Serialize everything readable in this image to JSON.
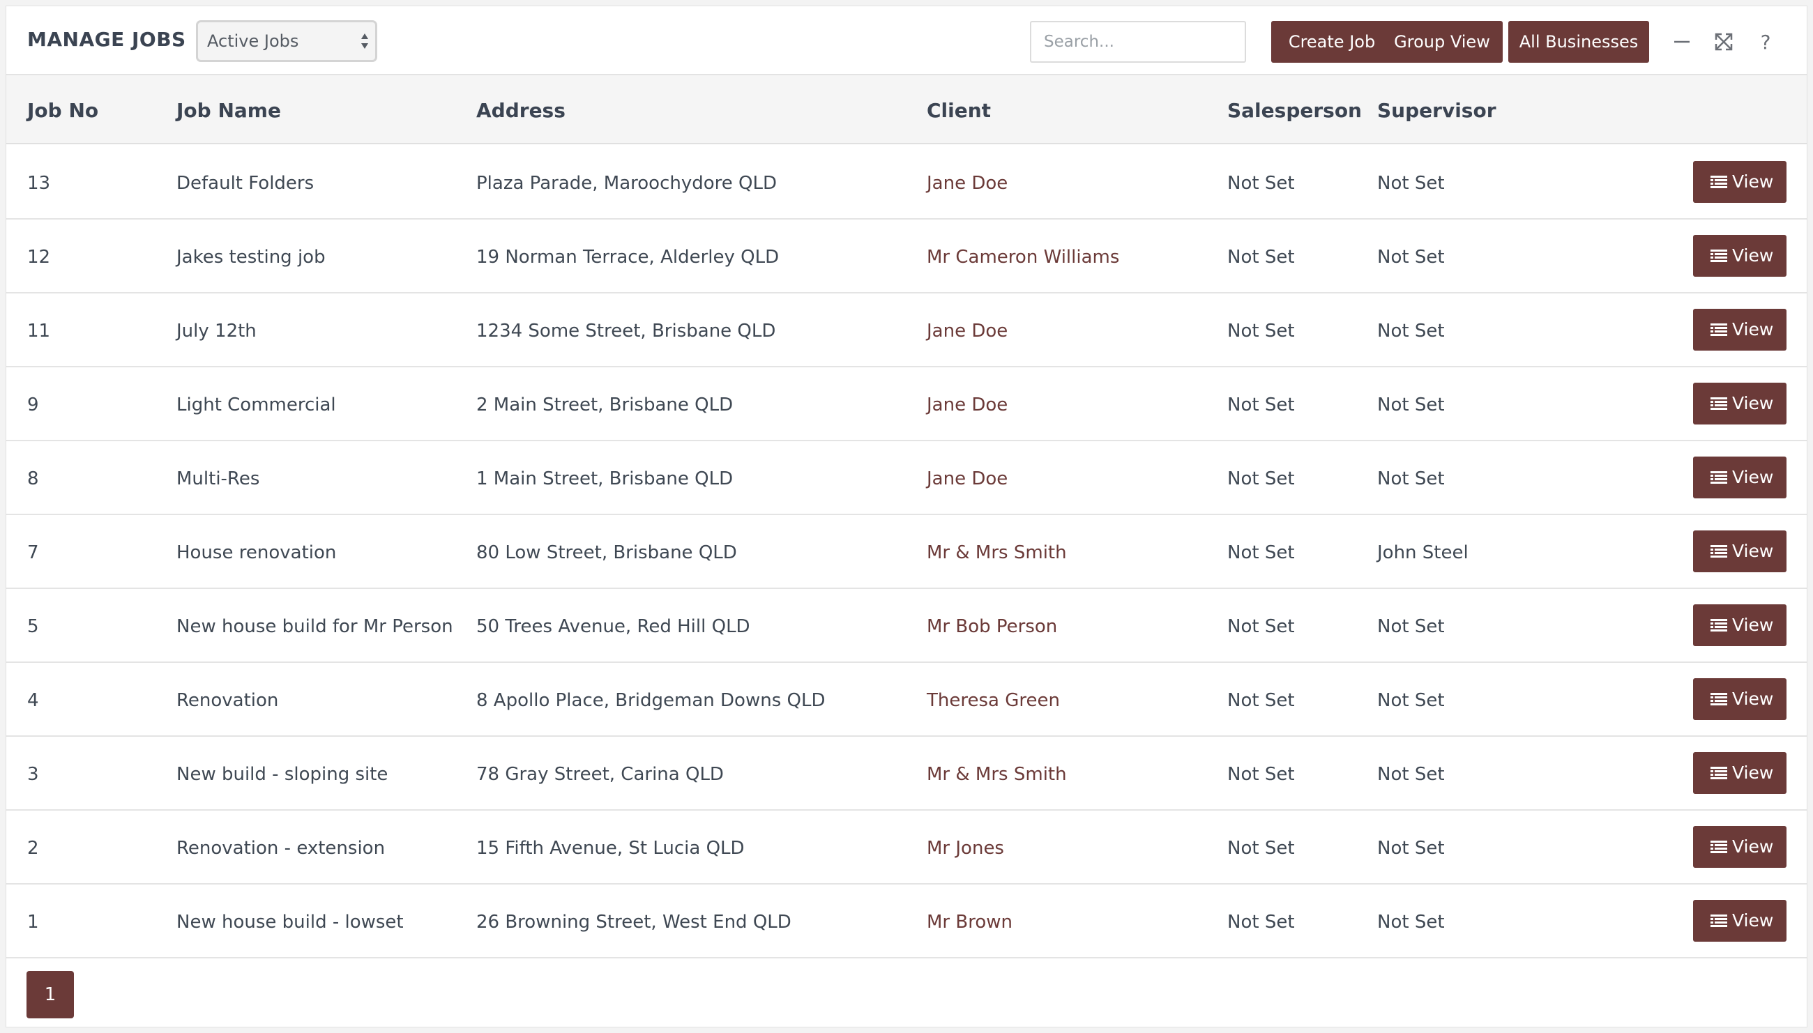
{
  "header": {
    "title": "MANAGE JOBS",
    "filter_selected": "Active Jobs",
    "search_placeholder": "Search...",
    "create_label": "Create Job",
    "group_label": "Group View",
    "businesses_label": "All Businesses",
    "icons": [
      "minimize-icon",
      "expand-icon",
      "help-icon"
    ]
  },
  "table": {
    "columns": [
      "Job No",
      "Job Name",
      "Address",
      "Client",
      "Salesperson",
      "Supervisor"
    ],
    "view_label": "View",
    "rows": [
      {
        "no": "13",
        "name": "Default Folders",
        "address": "Plaza Parade, Maroochydore QLD",
        "client": "Jane Doe",
        "salesperson": "Not Set",
        "supervisor": "Not Set"
      },
      {
        "no": "12",
        "name": "Jakes testing job",
        "address": "19 Norman Terrace, Alderley QLD",
        "client": "Mr Cameron Williams",
        "salesperson": "Not Set",
        "supervisor": "Not Set"
      },
      {
        "no": "11",
        "name": "July 12th",
        "address": "1234 Some Street, Brisbane QLD",
        "client": "Jane Doe",
        "salesperson": "Not Set",
        "supervisor": "Not Set"
      },
      {
        "no": "9",
        "name": "Light Commercial",
        "address": "2 Main Street, Brisbane QLD",
        "client": "Jane Doe",
        "salesperson": "Not Set",
        "supervisor": "Not Set"
      },
      {
        "no": "8",
        "name": "Multi-Res",
        "address": "1 Main Street, Brisbane QLD",
        "client": "Jane Doe",
        "salesperson": "Not Set",
        "supervisor": "Not Set"
      },
      {
        "no": "7",
        "name": "House renovation",
        "address": "80 Low Street, Brisbane QLD",
        "client": "Mr & Mrs Smith",
        "salesperson": "Not Set",
        "supervisor": "John Steel"
      },
      {
        "no": "5",
        "name": "New house build for Mr Person",
        "address": "50 Trees Avenue, Red Hill QLD",
        "client": "Mr Bob Person",
        "salesperson": "Not Set",
        "supervisor": "Not Set"
      },
      {
        "no": "4",
        "name": "Renovation",
        "address": "8 Apollo Place, Bridgeman Downs QLD",
        "client": "Theresa Green",
        "salesperson": "Not Set",
        "supervisor": "Not Set"
      },
      {
        "no": "3",
        "name": "New build - sloping site",
        "address": "78 Gray Street, Carina QLD",
        "client": "Mr & Mrs Smith",
        "salesperson": "Not Set",
        "supervisor": "Not Set"
      },
      {
        "no": "2",
        "name": "Renovation - extension",
        "address": "15 Fifth Avenue, St Lucia QLD",
        "client": "Mr Jones",
        "salesperson": "Not Set",
        "supervisor": "Not Set"
      },
      {
        "no": "1",
        "name": "New house build - lowset",
        "address": "26 Browning Street, West End QLD",
        "client": "Mr Brown",
        "salesperson": "Not Set",
        "supervisor": "Not Set"
      }
    ]
  },
  "pagination": {
    "current_page": "1"
  },
  "colors": {
    "accent": "#6b3a38",
    "text": "#3f4853",
    "header_bg": "#f5f5f5"
  }
}
